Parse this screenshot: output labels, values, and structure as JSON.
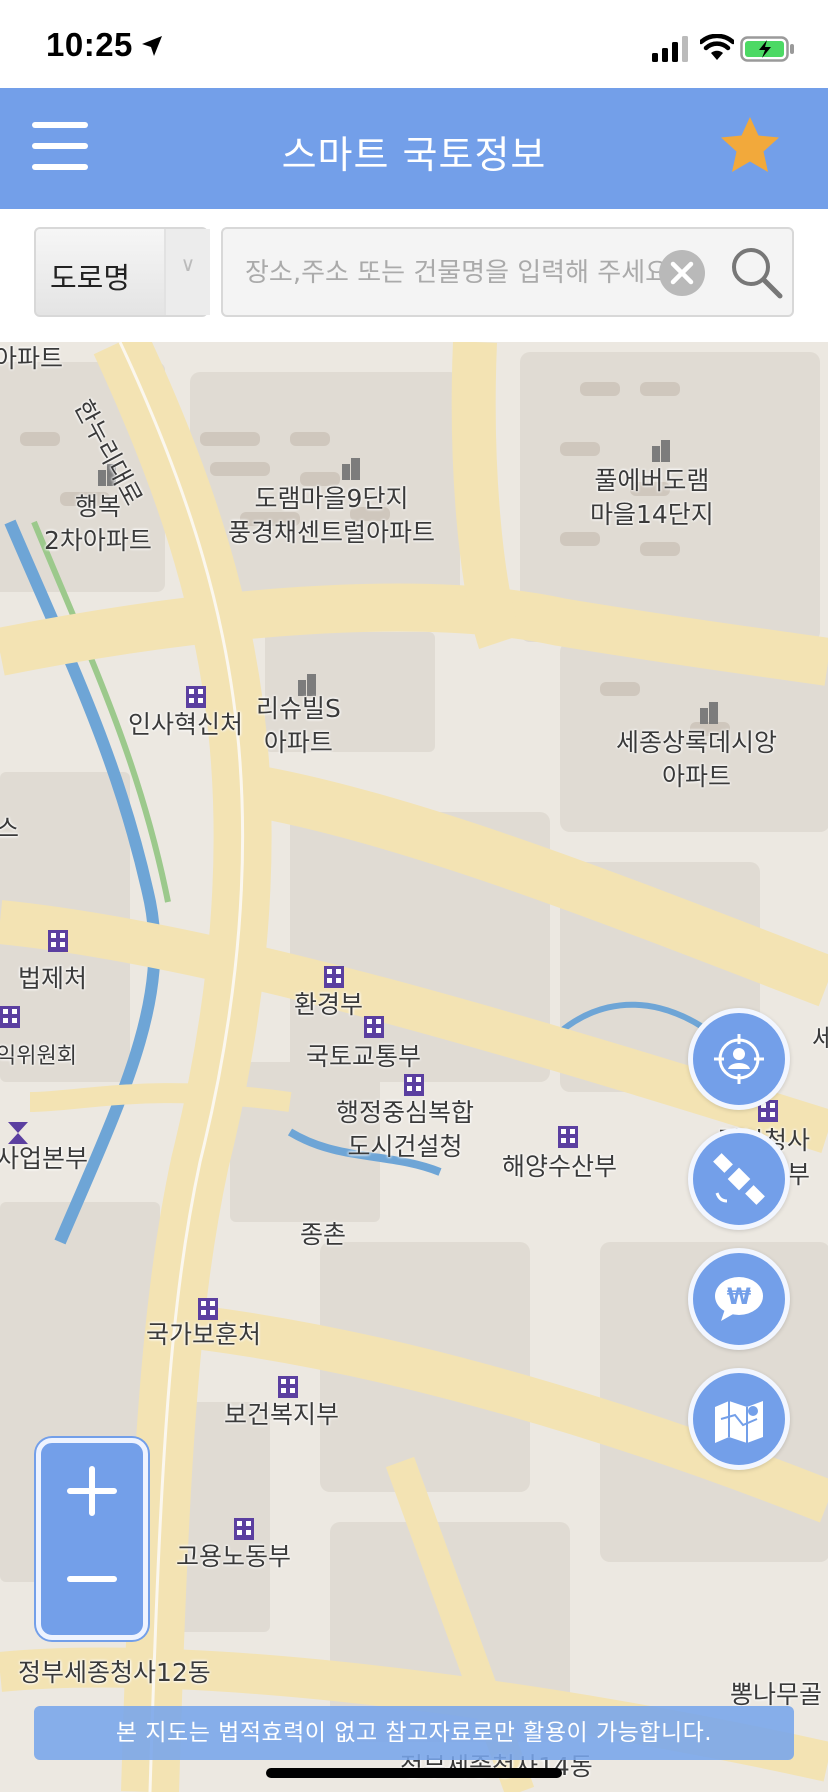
{
  "status_bar": {
    "time": "10:25"
  },
  "header": {
    "title": "스마트 국토정보",
    "menu_icon": "hamburger-menu-icon",
    "favorite_icon": "star-icon",
    "star_color": "#f2a93b"
  },
  "search": {
    "type_selected": "도로명",
    "placeholder": "장소,주소 또는 건물명을 입력해 주세요",
    "clear_icon": "clear-icon",
    "search_icon": "magnifier-icon"
  },
  "map": {
    "labels": {
      "apt_top": "아파트",
      "road_hannuri": "한누리대로",
      "haengbok": "행복\n2차아파트",
      "doram9": "도램마을9단지\n풍경채센트럴아파트",
      "pulebeo": "풀에버도램\n마을14단지",
      "insa": "인사혁신처",
      "richuville": "리슈빌S\n아파트",
      "sejong_sangrok": "세종상록데시앙\n아파트",
      "left_s": "스",
      "bupje": "법제처",
      "committee": "익위원회",
      "hwangyeong": "환경부",
      "gukto": "국토교통부",
      "haengjung": "행정중심복합\n도시건설청",
      "haeyang": "해양수산부",
      "right_se": "세",
      "jeongbu_right": "정부청사\n부",
      "saeop": "사업본부",
      "jongchon": "종촌",
      "bohun": "국가보훈처",
      "bokji": "보건복지부",
      "goyong": "고용노동부",
      "cheongsa12": "정부세종청사12동",
      "bbongnamu": "뽕나무골",
      "cheongsa14": "정부세종청사14동"
    }
  },
  "controls": {
    "locate_icon": "my-location-icon",
    "satellite_icon": "satellite-icon",
    "price_icon": "won-speech-bubble-icon",
    "map_layers_icon": "folded-map-icon",
    "zoom_in_icon": "plus-icon",
    "zoom_out_icon": "minus-icon"
  },
  "disclaimer": "본 지도는 법적효력이 없고 참고자료로만 활용이 가능합니다.",
  "colors": {
    "accent": "#739fe9",
    "road": "#f3e3b3",
    "block": "#e3ded7",
    "water": "#6ea5d6"
  }
}
